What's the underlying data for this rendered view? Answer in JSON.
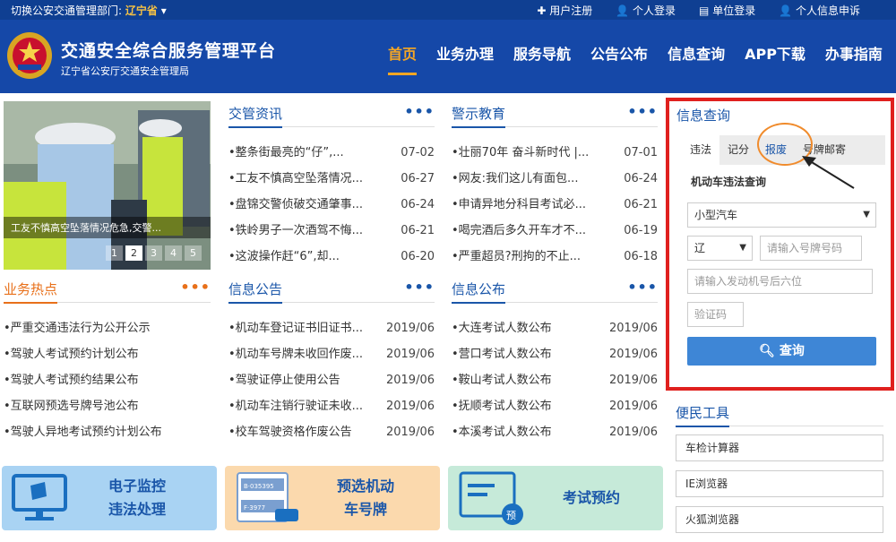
{
  "topbar": {
    "switch_label": "切换公安交通管理部门:",
    "province": "辽宁省",
    "links": [
      "用户注册",
      "个人登录",
      "单位登录",
      "个人信息申诉"
    ]
  },
  "header": {
    "title": "交通安全综合服务管理平台",
    "subtitle": "辽宁省公安厅交通安全管理局",
    "nav": [
      "首页",
      "业务办理",
      "服务导航",
      "公告公布",
      "信息查询",
      "APP下载",
      "办事指南"
    ]
  },
  "slideshow": {
    "caption": "工友不慎高空坠落情况危急,交警...",
    "pages": [
      "1",
      "2",
      "3",
      "4",
      "5"
    ],
    "active_page": "2"
  },
  "sections": {
    "news": {
      "title": "交管资讯",
      "items": [
        {
          "text": "整条街最亮的“仔”,...",
          "date": "07-02"
        },
        {
          "text": "工友不慎高空坠落情况...",
          "date": "06-27"
        },
        {
          "text": "盘锦交警侦破交通肇事...",
          "date": "06-24"
        },
        {
          "text": "铁岭男子一次酒驾不悔...",
          "date": "06-21"
        },
        {
          "text": "这波操作赶“6”,却...",
          "date": "06-20"
        }
      ]
    },
    "warning": {
      "title": "警示教育",
      "items": [
        {
          "text": "壮丽70年 奋斗新时代 |...",
          "date": "07-01"
        },
        {
          "text": "网友:我们这儿有面包...",
          "date": "06-24"
        },
        {
          "text": "申请异地分科目考试必...",
          "date": "06-21"
        },
        {
          "text": "喝完酒后多久开车才不...",
          "date": "06-19"
        },
        {
          "text": "严重超员?刑拘的不止...",
          "date": "06-18"
        }
      ]
    },
    "hot": {
      "title": "业务热点",
      "items": [
        {
          "text": "严重交通违法行为公开公示"
        },
        {
          "text": "驾驶人考试预约计划公布"
        },
        {
          "text": "驾驶人考试预约结果公布"
        },
        {
          "text": "互联网预选号牌号池公布"
        },
        {
          "text": "驾驶人异地考试预约计划公布"
        }
      ]
    },
    "notice": {
      "title": "信息公告",
      "items": [
        {
          "text": "机动车登记证书旧证书...",
          "date": "2019/06"
        },
        {
          "text": "机动车号牌未收回作废...",
          "date": "2019/06"
        },
        {
          "text": "驾驶证停止使用公告",
          "date": "2019/06"
        },
        {
          "text": "机动车注销行驶证未收...",
          "date": "2019/06"
        },
        {
          "text": "校车驾驶资格作废公告",
          "date": "2019/06"
        }
      ]
    },
    "info": {
      "title": "信息公布",
      "items": [
        {
          "text": "大连考试人数公布",
          "date": "2019/06"
        },
        {
          "text": "营口考试人数公布",
          "date": "2019/06"
        },
        {
          "text": "鞍山考试人数公布",
          "date": "2019/06"
        },
        {
          "text": "抚顺考试人数公布",
          "date": "2019/06"
        },
        {
          "text": "本溪考试人数公布",
          "date": "2019/06"
        }
      ]
    },
    "more": "•••"
  },
  "banners": {
    "monitor": {
      "line1": "电子监控",
      "line2": "违法处理"
    },
    "plate": {
      "line1": "预选机动",
      "line2": "车号牌",
      "plate1": "B·035395",
      "plate2": "F·3977"
    },
    "exam": {
      "label": "考试预约",
      "badge": "预"
    }
  },
  "query": {
    "title": "信息查询",
    "tabs": [
      "违法",
      "记分",
      "报废",
      "号牌邮寄"
    ],
    "active_tab": "违法",
    "subtitle": "机动车违法查询",
    "vehicle_type": "小型汽车",
    "province_short": "辽",
    "plate_placeholder": "请输入号牌号码",
    "engine_placeholder": "请输入发动机号后六位",
    "captcha_placeholder": "验证码",
    "button": "查询"
  },
  "tools": {
    "title": "便民工具",
    "items": [
      "车检计算器",
      "IE浏览器",
      "火狐浏览器"
    ]
  },
  "colors": {
    "header_bg": "#1548a8",
    "topbar_bg": "#0f3f92",
    "accent_orange": "#f6a623",
    "link_blue": "#1a56a9",
    "highlight_red": "#e0201e"
  }
}
